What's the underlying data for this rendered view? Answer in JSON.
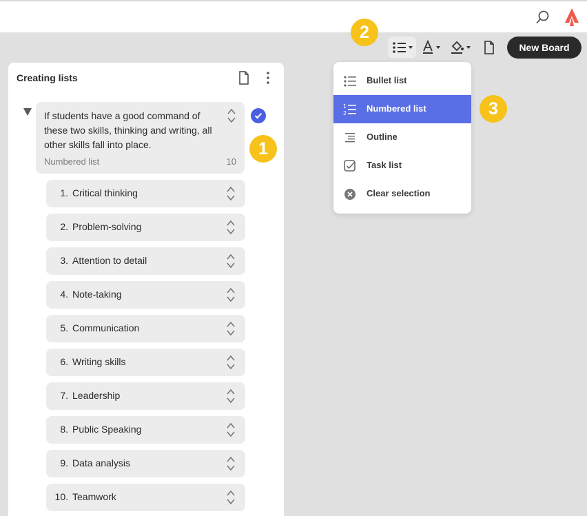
{
  "toolbar": {
    "new_board_label": "New Board"
  },
  "badges": {
    "one": "1",
    "two": "2",
    "three": "3"
  },
  "panel": {
    "title": "Creating lists"
  },
  "main_card": {
    "text": "If students have a good command of these two skills, thinking and writing, all other skills fall into place.",
    "subtitle": "Numbered list",
    "count": "10"
  },
  "items": [
    {
      "num": "1.",
      "label": "Critical thinking"
    },
    {
      "num": "2.",
      "label": "Problem-solving"
    },
    {
      "num": "3.",
      "label": "Attention to detail"
    },
    {
      "num": "4.",
      "label": "Note-taking"
    },
    {
      "num": "5.",
      "label": "Communication"
    },
    {
      "num": "6.",
      "label": "Writing skills"
    },
    {
      "num": "7.",
      "label": "Leadership"
    },
    {
      "num": "8.",
      "label": "Public Speaking"
    },
    {
      "num": "9.",
      "label": "Data analysis"
    },
    {
      "num": "10.",
      "label": "Teamwork"
    }
  ],
  "menu": {
    "items": [
      {
        "label": "Bullet list",
        "icon": "bullet-list-icon"
      },
      {
        "label": "Numbered list",
        "icon": "numbered-list-icon",
        "active": true
      },
      {
        "label": "Outline",
        "icon": "outline-icon"
      },
      {
        "label": "Task list",
        "icon": "task-list-icon"
      },
      {
        "label": "Clear selection",
        "icon": "clear-selection-icon"
      }
    ]
  },
  "colors": {
    "accent": "#5a6ee6",
    "badge": "#f7c21a",
    "check": "#4a5fe0",
    "new_board_bg": "#2a2a2a",
    "logo": "#f2594b"
  }
}
